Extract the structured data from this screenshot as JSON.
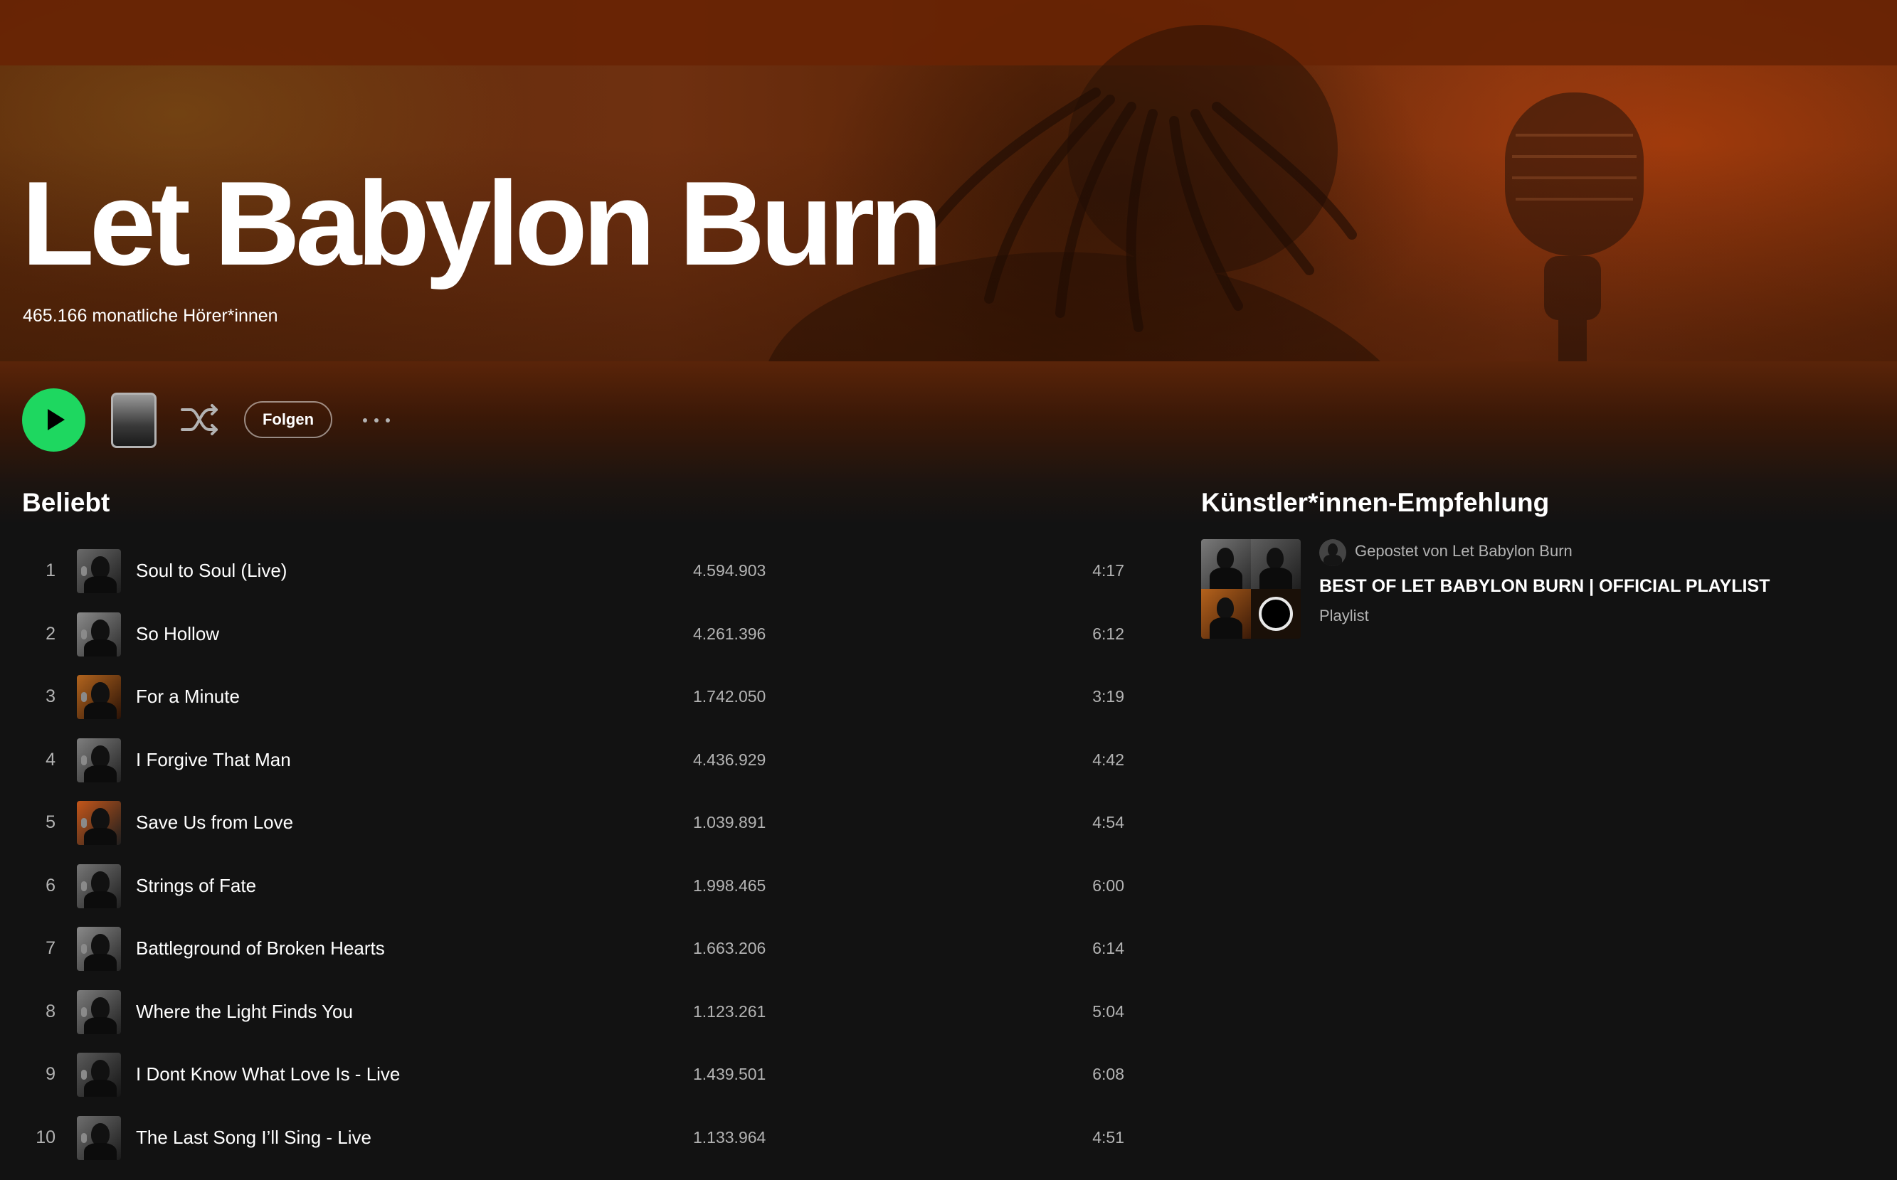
{
  "artist": {
    "name": "Let Babylon Burn",
    "monthly_listeners": "465.166 monatliche Hörer*innen"
  },
  "actions": {
    "play_icon": "play-icon",
    "shuffle_icon": "shuffle-icon",
    "follow_label": "Folgen",
    "more_icon": "more-options-icon"
  },
  "popular": {
    "title": "Beliebt",
    "tracks": [
      {
        "num": "1",
        "title": "Soul to Soul (Live)",
        "plays": "4.594.903",
        "duration": "4:17"
      },
      {
        "num": "2",
        "title": "So Hollow",
        "plays": "4.261.396",
        "duration": "6:12"
      },
      {
        "num": "3",
        "title": "For a Minute",
        "plays": "1.742.050",
        "duration": "3:19"
      },
      {
        "num": "4",
        "title": "I Forgive That Man",
        "plays": "4.436.929",
        "duration": "4:42"
      },
      {
        "num": "5",
        "title": "Save Us from Love",
        "plays": "1.039.891",
        "duration": "4:54"
      },
      {
        "num": "6",
        "title": "Strings of Fate",
        "plays": "1.998.465",
        "duration": "6:00"
      },
      {
        "num": "7",
        "title": "Battleground of Broken Hearts",
        "plays": "1.663.206",
        "duration": "6:14"
      },
      {
        "num": "8",
        "title": "Where the Light Finds You",
        "plays": "1.123.261",
        "duration": "5:04"
      },
      {
        "num": "9",
        "title": "I Dont Know What Love Is - Live",
        "plays": "1.439.501",
        "duration": "6:08"
      },
      {
        "num": "10",
        "title": "The Last Song I’ll Sing - Live",
        "plays": "1.133.964",
        "duration": "4:51"
      }
    ]
  },
  "artist_pick": {
    "title": "Künstler*innen-Empfehlung",
    "posted_by": "Gepostet von Let Babylon Burn",
    "name": "BEST OF LET BABYLON BURN | OFFICIAL PLAYLIST",
    "type": "Playlist"
  },
  "colors": {
    "accent_green": "#1ed760",
    "background": "#121212",
    "secondary_text": "#b3b3b3",
    "hero_orange": "#6f3010"
  }
}
